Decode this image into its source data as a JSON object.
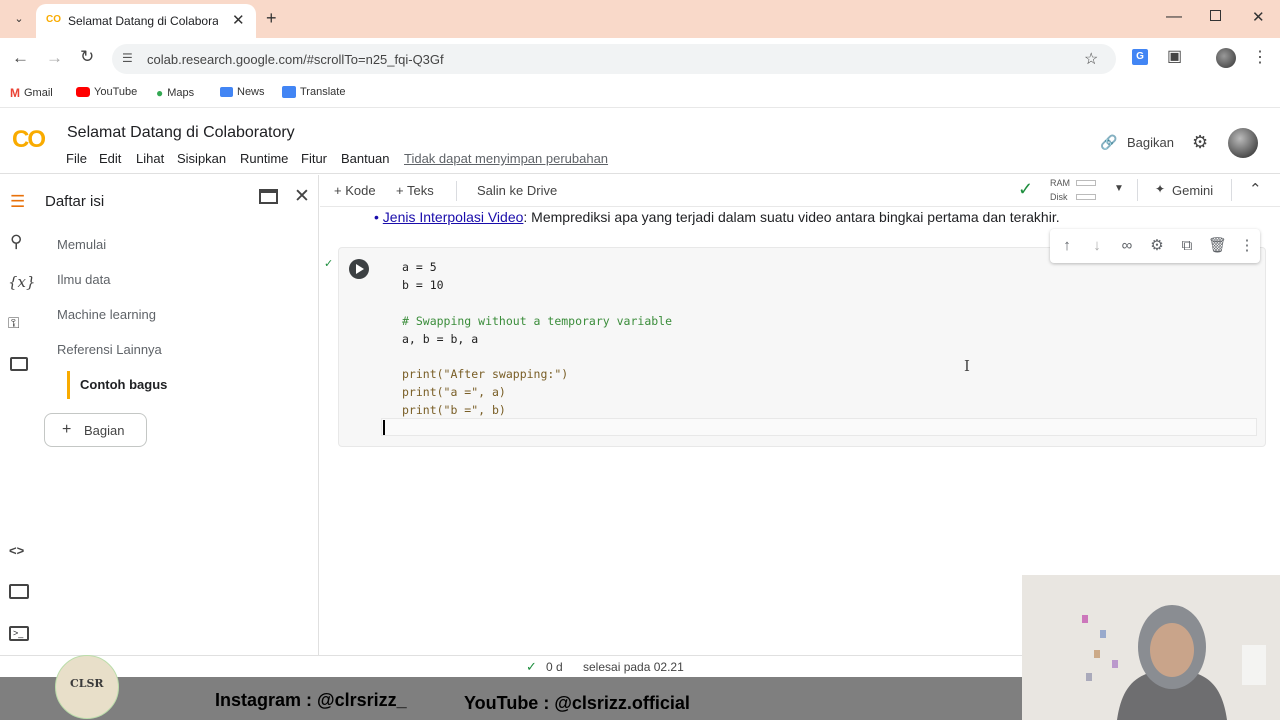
{
  "browser": {
    "tab_title": "Selamat Datang di Colaborator",
    "url": "colab.research.google.com/#scrollTo=n25_fqi-Q3Gf",
    "bookmarks": [
      "Gmail",
      "YouTube",
      "Maps",
      "News",
      "Translate"
    ]
  },
  "colab": {
    "title": "Selamat Datang di Colaboratory",
    "logo_text": "CO",
    "menu": [
      "File",
      "Edit",
      "Lihat",
      "Sisipkan",
      "Runtime",
      "Fitur",
      "Bantuan"
    ],
    "unsaved_notice": "Tidak dapat menyimpan perubahan",
    "share_label": "Bagikan"
  },
  "sidebar": {
    "title": "Daftar isi",
    "items": [
      "Memulai",
      "Ilmu data",
      "Machine learning",
      "Referensi Lainnya"
    ],
    "sub_item": "Contoh bagus",
    "add_section": "Bagian"
  },
  "nb_toolbar": {
    "add_code": "+ Kode",
    "add_text": "+ Teks",
    "copy_drive": "Salin ke Drive",
    "ram": "RAM",
    "disk": "Disk",
    "gemini": "Gemini"
  },
  "notebook": {
    "bullet_link": "Jenis Interpolasi Video",
    "bullet_text": ": Memprediksi apa yang terjadi dalam suatu video antara bingkai pertama dan terakhir.",
    "code_lines": [
      "a = 5",
      "b = 10",
      "",
      "# Swapping without a temporary variable",
      "a, b = b, a",
      "",
      "print(\"After swapping:\")",
      "print(\"a =\", a)",
      "print(\"b =\", b)"
    ]
  },
  "status": {
    "duration": "0 d",
    "completed": "selesai pada 02.21"
  },
  "overlay": {
    "instagram": "Instagram : @clrsrizz_",
    "youtube": "YouTube : @clsrizz.official",
    "logo_text": "CLSR"
  },
  "colors": {
    "tabbar": "#f9d9c9",
    "colab_orange": "#f9ab00",
    "link_blue": "#1a0dab",
    "check_green": "#1e8e3e"
  }
}
